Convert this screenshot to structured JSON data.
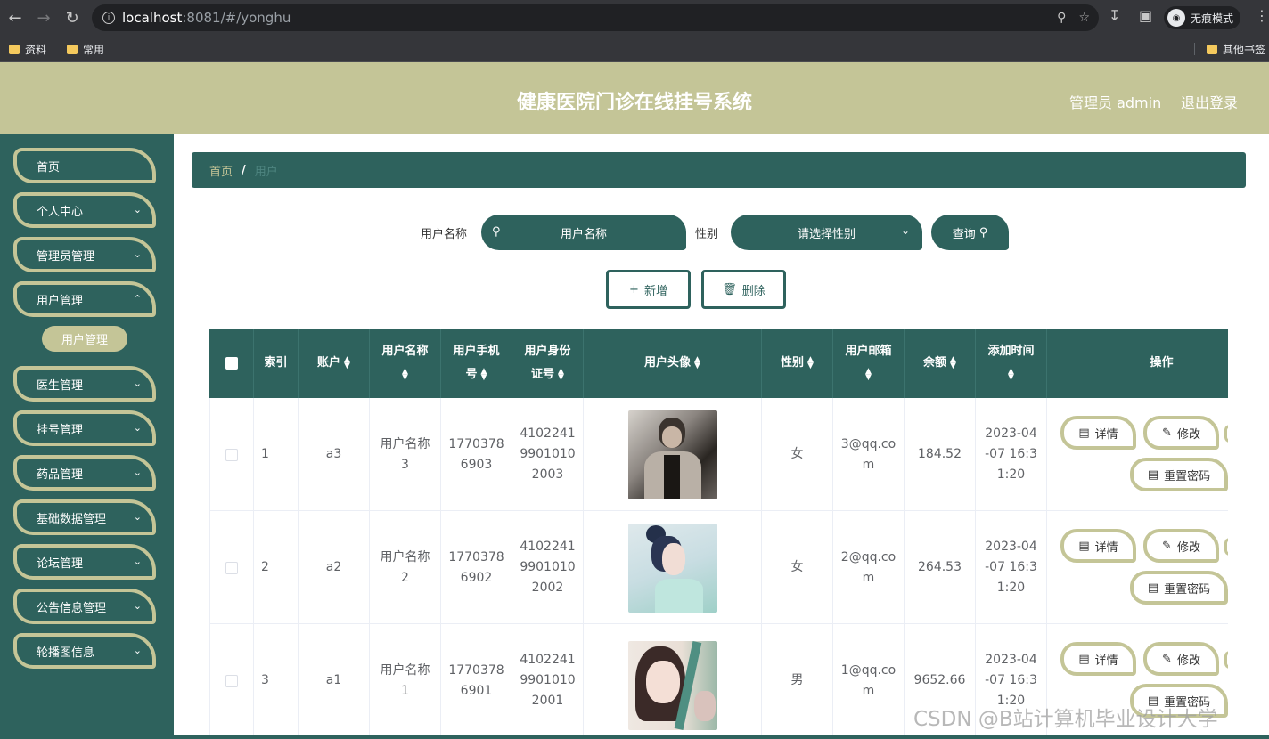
{
  "browser": {
    "url_host": "localhost",
    "url_path": ":8081/#/yonghu",
    "incognito_label": "无痕模式",
    "bookmarks": [
      "资料",
      "常用"
    ],
    "other_bookmarks": "其他书签"
  },
  "header": {
    "title": "健康医院门诊在线挂号系统",
    "user": "管理员 admin",
    "logout": "退出登录"
  },
  "sidebar": {
    "items": [
      {
        "label": "首页"
      },
      {
        "label": "个人中心"
      },
      {
        "label": "管理员管理"
      },
      {
        "label": "用户管理"
      },
      {
        "label": "医生管理"
      },
      {
        "label": "挂号管理"
      },
      {
        "label": "药品管理"
      },
      {
        "label": "基础数据管理"
      },
      {
        "label": "论坛管理"
      },
      {
        "label": "公告信息管理"
      },
      {
        "label": "轮播图信息"
      }
    ],
    "active_sub": "用户管理"
  },
  "breadcrumb": {
    "home": "首页",
    "sep": "/",
    "current": "用户"
  },
  "search": {
    "name_label": "用户名称",
    "name_placeholder": "用户名称",
    "gender_label": "性别",
    "gender_placeholder": "请选择性别",
    "query_label": "查询"
  },
  "actions": {
    "add": "新增",
    "delete": "删除"
  },
  "table": {
    "headers": {
      "index": "索引",
      "account": "账户",
      "username": "用户名称",
      "phone": "用户手机号",
      "idcard": "用户身份证号",
      "avatar": "用户头像",
      "gender": "性别",
      "email": "用户邮箱",
      "balance": "余额",
      "added": "添加时间",
      "ops": "操作"
    },
    "rows": [
      {
        "index": "1",
        "account": "a3",
        "username": "用户名称3",
        "phone": "17703786903",
        "idcard": "410224199010102003",
        "gender": "女",
        "email": "3@qq.com",
        "balance": "184.52",
        "added": "2023-04-07 16:31:20"
      },
      {
        "index": "2",
        "account": "a2",
        "username": "用户名称2",
        "phone": "17703786902",
        "idcard": "410224199010102002",
        "gender": "女",
        "email": "2@qq.com",
        "balance": "264.53",
        "added": "2023-04-07 16:31:20"
      },
      {
        "index": "3",
        "account": "a1",
        "username": "用户名称1",
        "phone": "17703786901",
        "idcard": "410224199010102001",
        "gender": "男",
        "email": "1@qq.com",
        "balance": "9652.66",
        "added": "2023-04-07 16:31:20"
      }
    ],
    "op_labels": {
      "detail": "详情",
      "edit": "修改",
      "reset": "重置密码"
    }
  },
  "watermark": "CSDN @B站计算机毕业设计大学",
  "colors": {
    "primary": "#2e625d",
    "accent": "#c4c597"
  }
}
